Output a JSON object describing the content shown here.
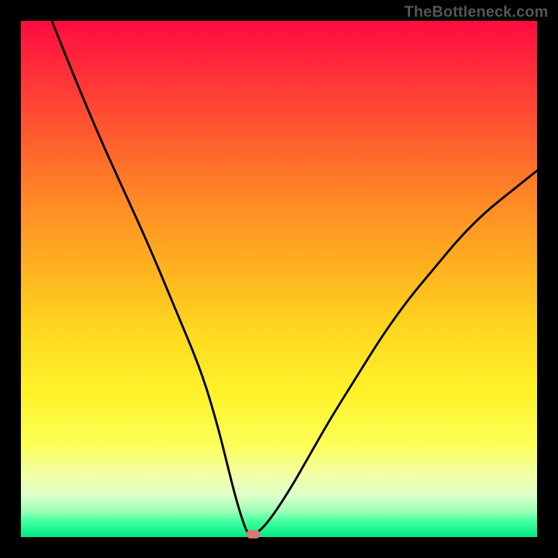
{
  "watermark": "TheBottleneck.com",
  "chart_data": {
    "type": "line",
    "title": "",
    "xlabel": "",
    "ylabel": "",
    "xlim": [
      0,
      100
    ],
    "ylim": [
      0,
      100
    ],
    "series": [
      {
        "name": "bottleneck-curve",
        "x": [
          6,
          10,
          15,
          20,
          25,
          30,
          35,
          38,
          40,
          41.5,
          43,
          44,
          45.5,
          48,
          52,
          56,
          60,
          65,
          70,
          75,
          80,
          85,
          90,
          95,
          100
        ],
        "values": [
          100,
          90,
          78,
          67,
          56,
          44,
          32,
          22,
          14,
          8,
          3,
          0.5,
          0.5,
          3,
          9,
          16,
          23,
          31,
          39,
          46,
          52,
          58,
          63,
          67,
          71
        ]
      }
    ],
    "marker": {
      "x": 45,
      "y": 0.5
    },
    "background_gradient": {
      "top": "#ff0b40",
      "middle": "#ffd81f",
      "bottom": "#00e885"
    }
  }
}
